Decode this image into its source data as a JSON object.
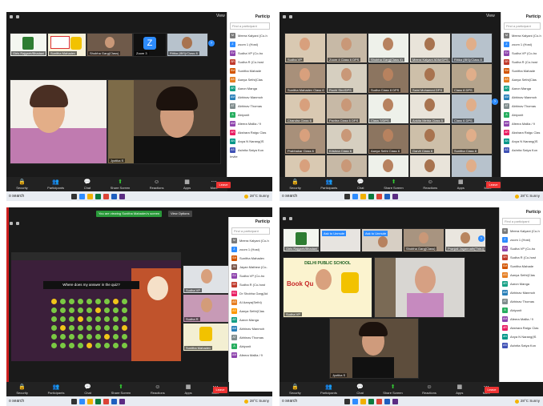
{
  "common": {
    "view_label": "View",
    "participants_title": "Particip",
    "search_placeholder": "Find a participant",
    "taskbar_search": "o search",
    "weather": "28°C Sunny",
    "end_label": "Leave",
    "controls": [
      "Security",
      "Participants",
      "Chat",
      "Share Screen",
      "Reactions",
      "Apps",
      "More"
    ]
  },
  "q1": {
    "thumbs": [
      {
        "name": "Girls Rajgarh/Bhadani"
      },
      {
        "name": "Sunitha Mahadev"
      },
      {
        "name": "Shobha Garg(Class)"
      },
      {
        "name": "Zoom 3"
      },
      {
        "name": "Ritika (IBS)/Class 8"
      }
    ],
    "zoom_letter": "Z",
    "main_tiles": [
      {
        "name": ""
      },
      {
        "name": "Jyotika S"
      }
    ],
    "participants": [
      {
        "initials": "M",
        "name": "Meera Kalyani (Co-h",
        "color": "#7a7a7a"
      },
      {
        "initials": "Z",
        "name": "zoom 1 (Host)",
        "color": "#2d8cff"
      },
      {
        "initials": "SV",
        "name": "Sudha VP (Co-ho",
        "color": "#8e44ad"
      },
      {
        "initials": "SR",
        "name": "Sudha R (Co-host",
        "color": "#c0392b"
      },
      {
        "initials": "SM",
        "name": "Sunitha Mahade",
        "color": "#d35400"
      },
      {
        "initials": "AS",
        "name": "Aanya Sethi(Clas",
        "color": "#e67e22"
      },
      {
        "initials": "AR",
        "name": "Aaron Manga",
        "color": "#16a085"
      },
      {
        "initials": "AM",
        "name": "Abhinav Manmoh",
        "color": "#2980b9"
      },
      {
        "initials": "AT",
        "name": "Abhinav Thomas",
        "color": "#7f8c8d"
      },
      {
        "initials": "A",
        "name": "Abiyonit",
        "color": "#27ae60"
      },
      {
        "initials": "AM",
        "name": "Afeera Mallia / 9",
        "color": "#8e44ad"
      },
      {
        "initials": "AR",
        "name": "Akshara Raigu Clas",
        "color": "#e91e63"
      },
      {
        "initials": "AN",
        "name": "Anya N Narang(IS",
        "color": "#009688"
      },
      {
        "initials": "AS",
        "name": "Ashrita Satya Kon",
        "color": "#3f51b5"
      }
    ],
    "invite_label": "Invite"
  },
  "q2": {
    "grid_names": [
      "Sudha VP",
      "Zoom 4 Class 6 DPS",
      "Shobha Garg(Class 4)",
      "Meera Kalyani ADM/DPS",
      "Ritika (IBS)/Class 8",
      "Sunitha Mahadev Class 6",
      "Ruchi Shri/DPS",
      "Sudha Class 8 DPS",
      "Saini Mohamed DPS",
      "Class 8 DPS",
      "Chandra Class 6",
      "Pavitra Class 6 DPS",
      "Class 7/DPS",
      "Ankita Mehta Class 5",
      "Class 6 DPS",
      "Prabhakar Class 6",
      "Krishna Class 6",
      "Aanya Sethi Class 6",
      "Garvit Class 6",
      "Sunitha Class 8",
      "Sumedha Class 6",
      "Mehak Class 6 DPS",
      "Ekta Class 5 DPS",
      "Aahar Class 6",
      "Akshita Class 5"
    ],
    "participants": [
      {
        "initials": "M",
        "name": "Meera Kalyani (Co-h",
        "color": "#7a7a7a"
      },
      {
        "initials": "Z",
        "name": "zoom 1 (Host)",
        "color": "#2d8cff"
      },
      {
        "initials": "SV",
        "name": "Sudha VP (Co-ho",
        "color": "#8e44ad"
      },
      {
        "initials": "SR",
        "name": "Sudha R (Co-host",
        "color": "#c0392b"
      },
      {
        "initials": "SM",
        "name": "Sunitha Mahade",
        "color": "#d35400"
      },
      {
        "initials": "AS",
        "name": "Aanya Sethi(Clas",
        "color": "#e67e22"
      },
      {
        "initials": "AR",
        "name": "Aaron Manga",
        "color": "#16a085"
      },
      {
        "initials": "AM",
        "name": "Abhinav Manmoh",
        "color": "#2980b9"
      },
      {
        "initials": "AT",
        "name": "Abhinav Thomas",
        "color": "#7f8c8d"
      },
      {
        "initials": "A",
        "name": "Abiyonit",
        "color": "#27ae60"
      },
      {
        "initials": "AM",
        "name": "Afeera Mallia / 9",
        "color": "#8e44ad"
      },
      {
        "initials": "AR",
        "name": "Akshara Raigu Clas",
        "color": "#e91e63"
      },
      {
        "initials": "AN",
        "name": "Anya N Narang(IS",
        "color": "#009688"
      },
      {
        "initials": "AS",
        "name": "Ashrita Satya Kon",
        "color": "#3f51b5"
      }
    ]
  },
  "q3": {
    "share_banner": "You are viewing Sunitha Mahadev's screen",
    "view_options": "View Options",
    "game_prompt": "Where does my answer in the quiz?",
    "side_tiles": [
      {
        "name": "Sudha VP"
      },
      {
        "name": "Sudha R"
      },
      {
        "name": "Sunitha Mahadev"
      }
    ],
    "participants": [
      {
        "initials": "M",
        "name": "Meera Kalyani (Co-h",
        "color": "#7a7a7a"
      },
      {
        "initials": "Z",
        "name": "zoom 1 (Host)",
        "color": "#2d8cff"
      },
      {
        "initials": "SM",
        "name": "Sunitha Mahadev",
        "color": "#d35400"
      },
      {
        "initials": "JM",
        "name": "Jayan Mathew (Co-",
        "color": "#795548"
      },
      {
        "initials": "SV",
        "name": "Sudha VP (Co-ho",
        "color": "#8e44ad"
      },
      {
        "initials": "SR",
        "name": "Sudha R (Co-host",
        "color": "#c0392b"
      },
      {
        "initials": "SG",
        "name": "Dr Shobha Garg(Ad",
        "color": "#e91e63"
      },
      {
        "initials": "AS",
        "name": "AI Aanya(Sethi)",
        "color": "#e67e22"
      },
      {
        "initials": "AS",
        "name": "Aanya Sethi(Clas",
        "color": "#ff9800"
      },
      {
        "initials": "AR",
        "name": "Aaron Manga",
        "color": "#16a085"
      },
      {
        "initials": "AM",
        "name": "Abhinav Manmoh",
        "color": "#2980b9"
      },
      {
        "initials": "AT",
        "name": "Abhinav Thomas",
        "color": "#7f8c8d"
      },
      {
        "initials": "A",
        "name": "Abiyonit",
        "color": "#27ae60"
      },
      {
        "initials": "AM",
        "name": "Afeera Mallia / 9",
        "color": "#8e44ad"
      }
    ]
  },
  "q4": {
    "thumbs": [
      {
        "name": "Girls Rajgarh/Bhadani"
      },
      {
        "name": "Ask to Unmute"
      },
      {
        "name": "Ask to Unmute"
      },
      {
        "name": "Shobha Garg(Class)"
      },
      {
        "name": "Pranjali Jagannath(Thiru)"
      }
    ],
    "slide_school": "DELHI PUBLIC SCHOOL",
    "slide_title": "Book Qu",
    "main_tiles": [
      {
        "name": "Sudha VP"
      },
      {
        "name": ""
      },
      {
        "name": "Jyotika S"
      }
    ],
    "participants": [
      {
        "initials": "M",
        "name": "Meera Kalyani (Co-h",
        "color": "#7a7a7a"
      },
      {
        "initials": "Z",
        "name": "zoom 1 (Host)",
        "color": "#2d8cff"
      },
      {
        "initials": "SV",
        "name": "Sudha VP (Co-ho",
        "color": "#8e44ad"
      },
      {
        "initials": "SR",
        "name": "Sudha R (Co-host",
        "color": "#c0392b"
      },
      {
        "initials": "SM",
        "name": "Sunitha Mahade",
        "color": "#d35400"
      },
      {
        "initials": "AS",
        "name": "Aanya Sethi(Clas",
        "color": "#e67e22"
      },
      {
        "initials": "AR",
        "name": "Aaron Manga",
        "color": "#16a085"
      },
      {
        "initials": "AM",
        "name": "Abhinav Manmoh",
        "color": "#2980b9"
      },
      {
        "initials": "AT",
        "name": "Abhinav Thomas",
        "color": "#7f8c8d"
      },
      {
        "initials": "A",
        "name": "Abiyonit",
        "color": "#27ae60"
      },
      {
        "initials": "AM",
        "name": "Afeera Mallia / 9",
        "color": "#8e44ad"
      },
      {
        "initials": "AR",
        "name": "Akshara Raigu Clas",
        "color": "#e91e63"
      },
      {
        "initials": "AN",
        "name": "Anya N Narang(IS",
        "color": "#009688"
      },
      {
        "initials": "AS",
        "name": "Ashrita Satya Kon",
        "color": "#3f51b5"
      }
    ]
  }
}
